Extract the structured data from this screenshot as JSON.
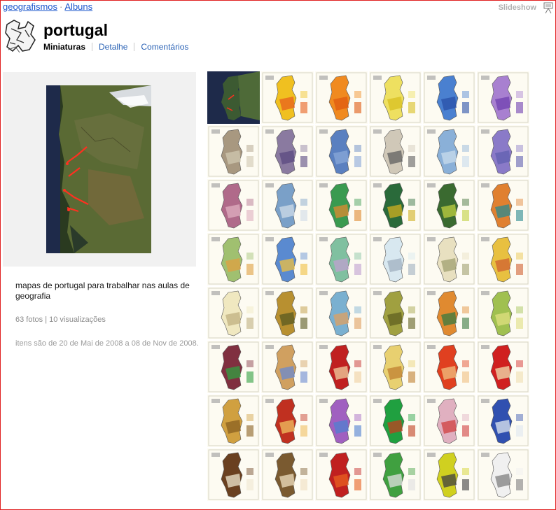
{
  "breadcrumb": {
    "user": "geografismos",
    "separator": "·",
    "albums": "Albuns"
  },
  "slideshow_label": "Slideshow",
  "album": {
    "title": "portugal",
    "tabs": [
      {
        "label": "Miniaturas",
        "active": true
      },
      {
        "label": "Detalhe",
        "active": false
      },
      {
        "label": "Comentários",
        "active": false
      }
    ],
    "description": "mapas de portugal para trabalhar nas aulas de geografia",
    "stats": "63 fotos | 10 visualizações",
    "date_range": "itens são de 20 de Mai de 2008 a 08 de Nov de 2008."
  },
  "colors": {
    "link": "#1a55cc",
    "tab_link": "#2a62b5",
    "frame": "#e02020",
    "panel_bg": "#f1f1f1"
  },
  "icons": {
    "slideshow": "slideshow-icon",
    "avatar": "user-avatar-sketch"
  },
  "thumbnails": [
    [
      "#3c5a32",
      "#4e6a38"
    ],
    [
      "#f0c020",
      "#e8601c"
    ],
    [
      "#f08a20",
      "#e05a10"
    ],
    [
      "#eee060",
      "#d8c020"
    ],
    [
      "#4a80d0",
      "#2a50a8"
    ],
    [
      "#a880d0",
      "#7040b0"
    ],
    [
      "#a89880",
      "#d0c8b0"
    ],
    [
      "#8a7aa0",
      "#5a4a80"
    ],
    [
      "#5a80c0",
      "#8aa8d8"
    ],
    [
      "#d0c8b8",
      "#606060"
    ],
    [
      "#8ab0d8",
      "#c8dcec"
    ],
    [
      "#8a7ac8",
      "#6060b0"
    ],
    [
      "#b06a8a",
      "#e0b0c0"
    ],
    [
      "#7aa0c8",
      "#d0dce8"
    ],
    [
      "#3a9a50",
      "#e08a30"
    ],
    [
      "#2a6a3a",
      "#d0b020"
    ],
    [
      "#3a6a30",
      "#c0d040"
    ],
    [
      "#e08030",
      "#2a8a90"
    ],
    [
      "#a0c070",
      "#e0a040"
    ],
    [
      "#5a8ad0",
      "#f0c040"
    ],
    [
      "#80c0a0",
      "#c0a0d0"
    ],
    [
      "#d8e8f0",
      "#a0b0c0"
    ],
    [
      "#e8e0c0",
      "#a0a070"
    ],
    [
      "#e8c040",
      "#d06030"
    ],
    [
      "#f0e8c0",
      "#c0b080"
    ],
    [
      "#b89030",
      "#5a5a20"
    ],
    [
      "#7ab0d0",
      "#e0a060"
    ],
    [
      "#a0a040",
      "#606020"
    ],
    [
      "#e08a30",
      "#3a7a40"
    ],
    [
      "#a0c050",
      "#e0e080"
    ],
    [
      "#803040",
      "#30a040"
    ],
    [
      "#d0a060",
      "#6a8ad0"
    ],
    [
      "#c02020",
      "#f0d0a0"
    ],
    [
      "#e8d070",
      "#c08030"
    ],
    [
      "#e04020",
      "#f0c080"
    ],
    [
      "#d02020",
      "#f0e0b0"
    ],
    [
      "#d0a040",
      "#8a6020"
    ],
    [
      "#c03020",
      "#f0c060"
    ],
    [
      "#a060c0",
      "#5080d0"
    ],
    [
      "#20a040",
      "#c04020"
    ],
    [
      "#e0b0c0",
      "#d04040"
    ],
    [
      "#3050b0",
      "#e0e8f0"
    ],
    [
      "#6a4020",
      "#f0e8d0"
    ],
    [
      "#7a5a30",
      "#f0e0c0"
    ],
    [
      "#c02020",
      "#e86020"
    ],
    [
      "#40a040",
      "#e0e0e0"
    ],
    [
      "#d0d020",
      "#404040"
    ],
    [
      "#f0f0f0",
      "#808080"
    ]
  ]
}
